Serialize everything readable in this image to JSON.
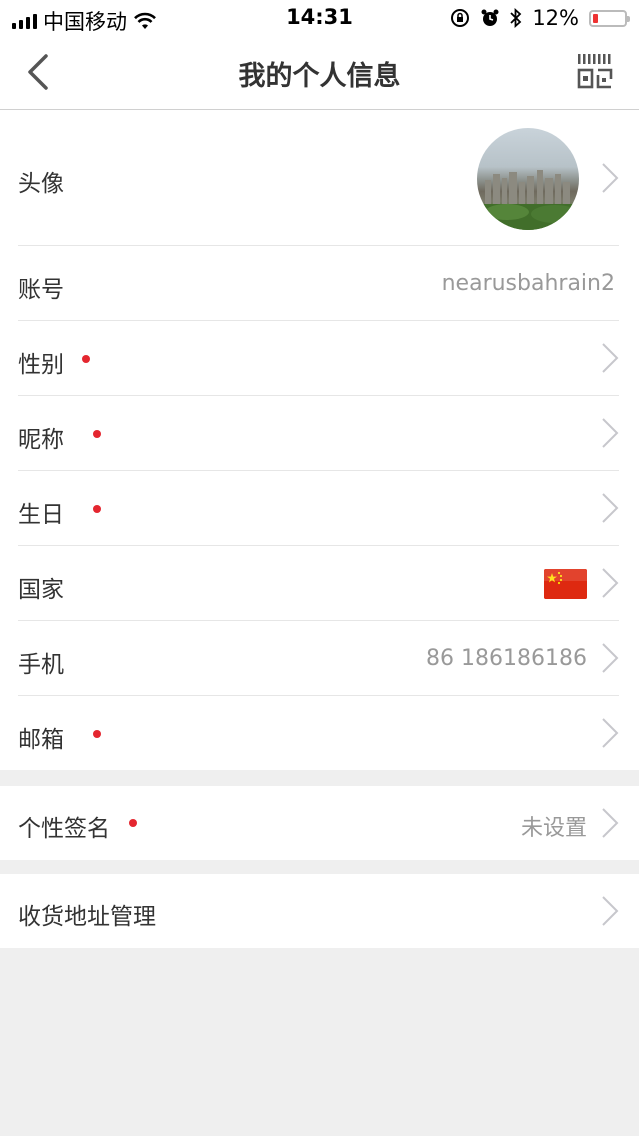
{
  "status_bar": {
    "carrier": "中国移动",
    "time": "14:31",
    "battery": "12%",
    "battery_level": 0.12
  },
  "nav": {
    "title": "我的个人信息",
    "back_icon": "chevron-left-icon",
    "qr_icon": "qr-code-icon"
  },
  "rows": {
    "avatar": {
      "label": "头像"
    },
    "account": {
      "label": "账号",
      "value": "nearusbahrain2"
    },
    "gender": {
      "label": "性别"
    },
    "nickname": {
      "label": "昵称"
    },
    "birthday": {
      "label": "生日"
    },
    "country": {
      "label": "国家",
      "flag": "china-flag"
    },
    "phone": {
      "label": "手机",
      "value": "86 186186186"
    },
    "email": {
      "label": "邮箱"
    },
    "signature": {
      "label": "个性签名",
      "value": "未设置"
    },
    "address": {
      "label": "收货地址管理"
    }
  },
  "colors": {
    "dot": "#e4262f",
    "background": "#efefef",
    "value_text": "#999999"
  }
}
